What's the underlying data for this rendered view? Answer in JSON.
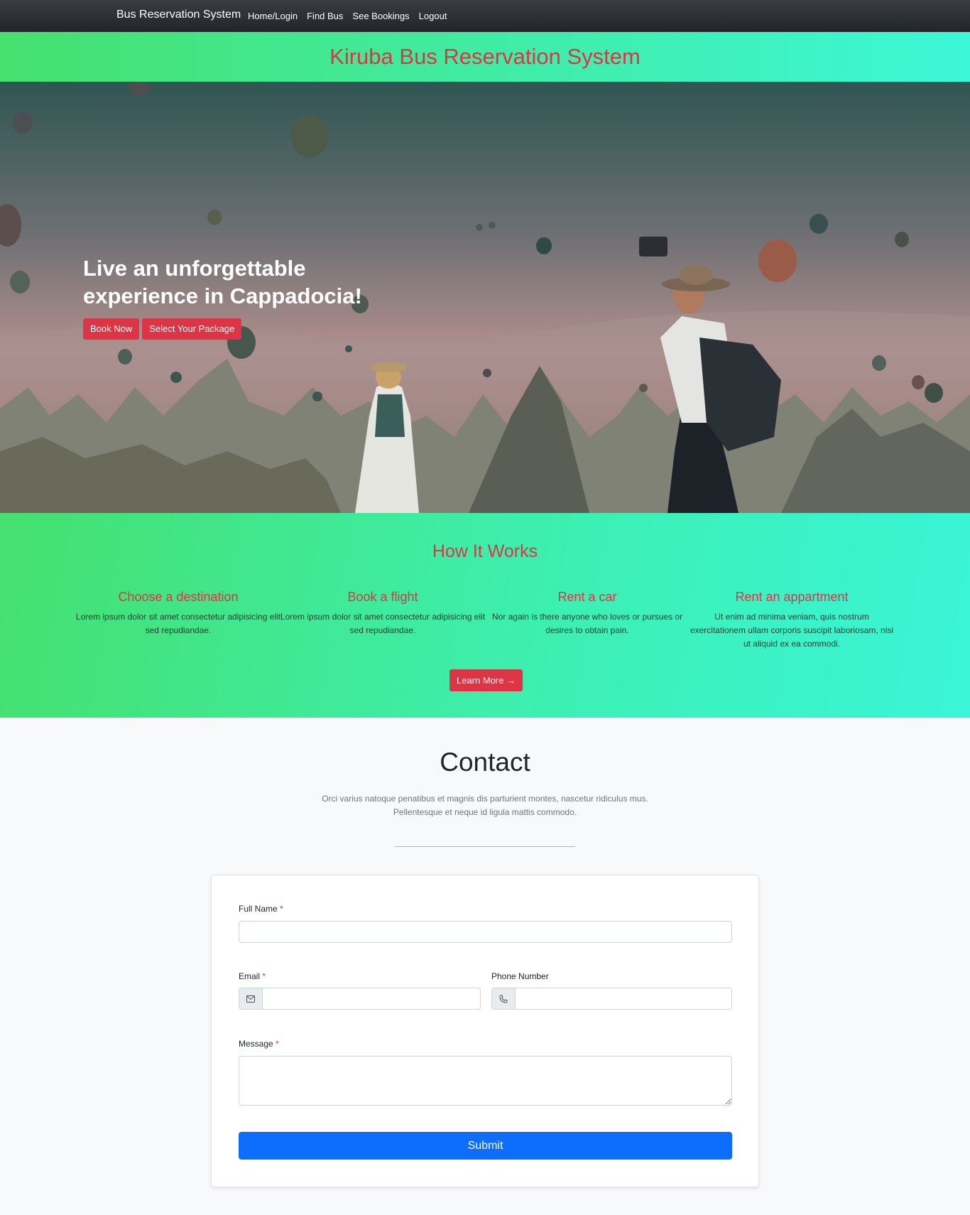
{
  "navbar": {
    "brand": "Bus Reservation System",
    "links": [
      "Home/Login",
      "Find Bus",
      "See Bookings",
      "Logout"
    ]
  },
  "header": {
    "title": "Kiruba Bus Reservation System"
  },
  "hero": {
    "line1": "Live an unforgettable",
    "line2": "experience in Cappadocia!",
    "book_now": "Book Now",
    "select_package": "Select Your Package"
  },
  "how": {
    "title": "How It Works",
    "steps": [
      {
        "title": "Choose a destination",
        "text": "Lorem ipsum dolor sit amet consectetur adipisicing elit sed repudiandae."
      },
      {
        "title": "Book a flight",
        "text": "Lorem ipsum dolor sit amet consectetur adipisicing elit sed repudiandae."
      },
      {
        "title": "Rent a car",
        "text": "Nor again is there anyone who loves or pursues or desires to obtain pain."
      },
      {
        "title": "Rent an appartment",
        "text": "Ut enim ad minima veniam, quis nostrum exercitationem ullam corporis suscipit laboriosam, nisi ut aliquid ex ea commodi."
      }
    ],
    "learn_more": "Learn More →"
  },
  "contact": {
    "title": "Contact",
    "subtitle_line1": "Orci varius natoque penatibus et magnis dis parturient montes, nascetur ridiculus mus.",
    "subtitle_line2": "Pellentesque et neque id ligula mattis commodo.",
    "form": {
      "full_name_label": "Full Name",
      "full_name_value": "",
      "email_label": "Email",
      "email_value": "",
      "phone_label": "Phone Number",
      "phone_value": "",
      "message_label": "Message",
      "message_value": "",
      "required_marker": "*",
      "submit": "Submit"
    }
  },
  "colors": {
    "accent_red": "#dc3545",
    "primary_blue": "#0d6efd",
    "gradient_start": "#45e06e",
    "gradient_end": "#3cf7d8"
  }
}
